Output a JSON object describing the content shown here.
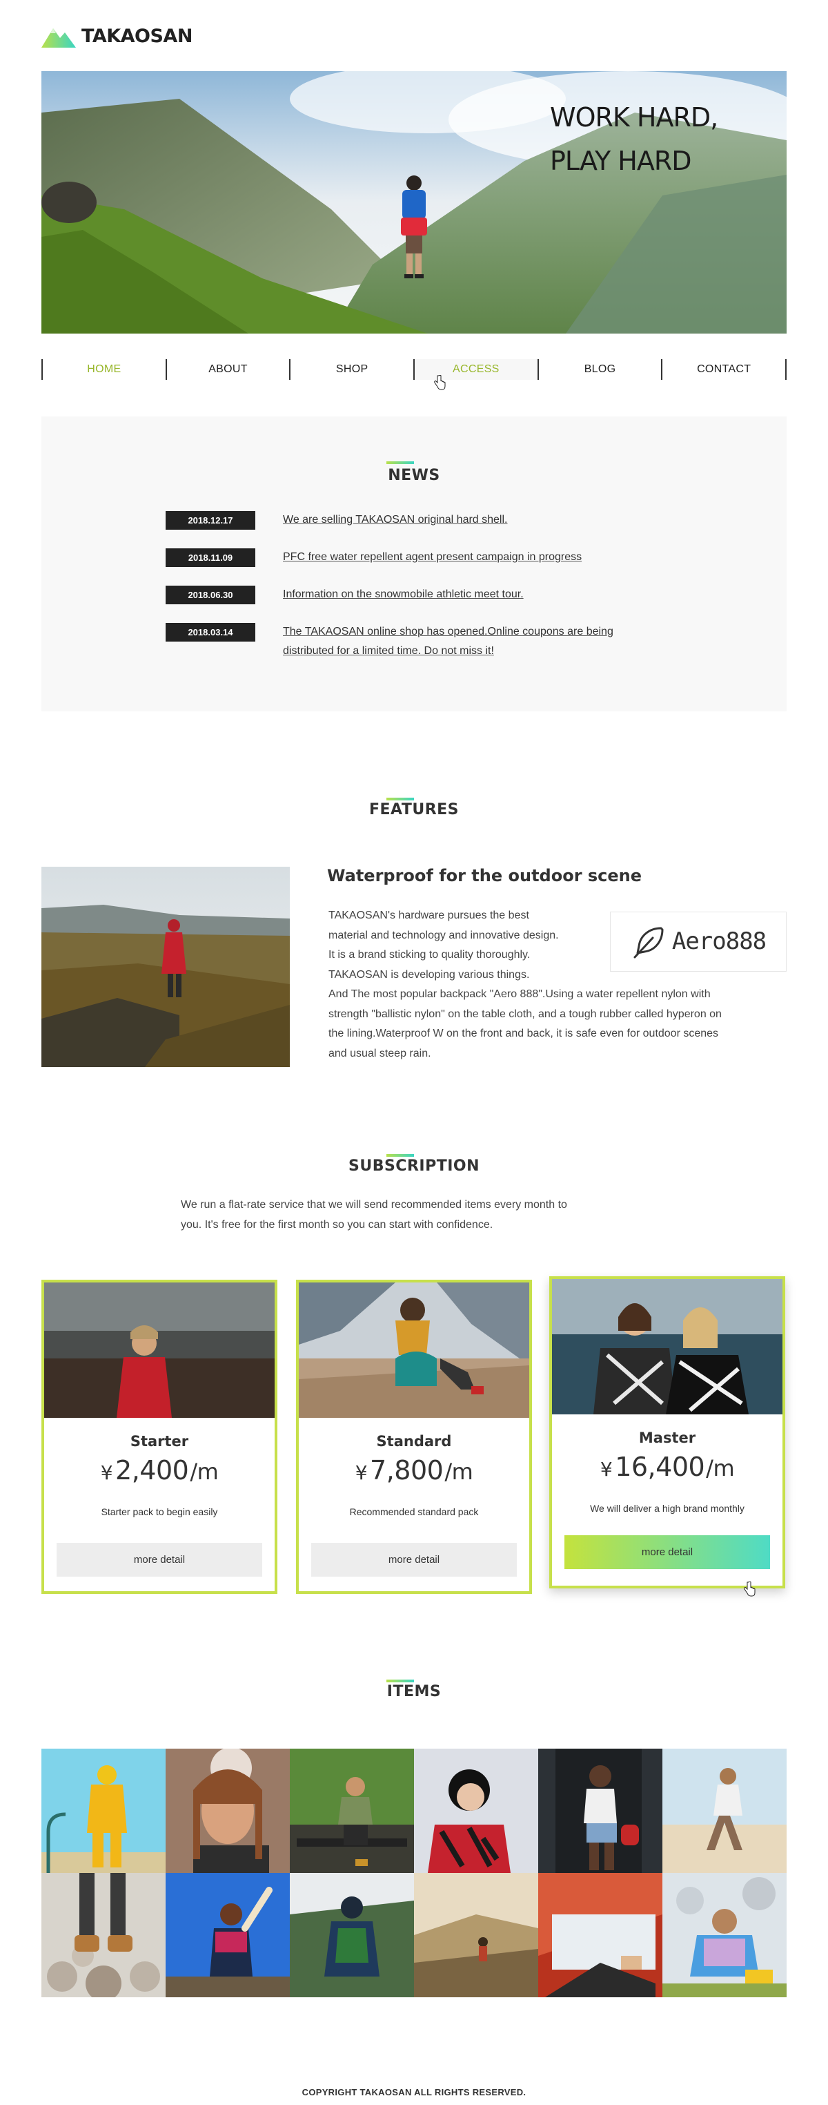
{
  "brand": {
    "name": "TAKAOSAN",
    "logo_icon": "mountain-icon"
  },
  "hero": {
    "line1": "WORK HARD,",
    "line2": "PLAY HARD"
  },
  "nav": {
    "items": [
      {
        "label": "HOME"
      },
      {
        "label": "ABOUT"
      },
      {
        "label": "SHOP"
      },
      {
        "label": "ACCESS"
      },
      {
        "label": "BLOG"
      },
      {
        "label": "CONTACT"
      }
    ],
    "active": "HOME",
    "hovered": "ACCESS"
  },
  "news": {
    "title": "NEWS",
    "items": [
      {
        "date": "2018.12.17",
        "text": "We are selling TAKAOSAN original hard shell."
      },
      {
        "date": "2018.11.09",
        "text": "PFC free water repellent agent present campaign in progress"
      },
      {
        "date": "2018.06.30",
        "text": "Information on the snowmobile athletic meet tour."
      },
      {
        "date": "2018.03.14",
        "line1": "The TAKAOSAN online shop has opened.Online coupons are being ",
        "line2": "distributed for a limited time. Do not miss it!"
      }
    ]
  },
  "features": {
    "title": "FEATURES",
    "heading": "Waterproof for the outdoor scene",
    "lines": [
      "TAKAOSAN's hardware pursues the best",
      "material and technology and innovative design.",
      "It is a brand sticking to quality thoroughly.",
      "TAKAOSAN is developing various things.",
      "And The most popular backpack \"Aero 888\".Using a water repellent nylon with",
      "strength \"ballistic nylon\" on the table cloth, and a tough rubber called hyperon on",
      "the lining.Waterproof W on the front and back, it is safe even for outdoor scenes",
      "and usual steep rain."
    ],
    "badge": {
      "label": "Aero888",
      "icon": "feather-icon"
    }
  },
  "subscription": {
    "title": "SUBSCRIPTION",
    "desc_line1": "We run a flat-rate service that we will send recommended items every month to",
    "desc_line2": "you. It's free for the first month so you can start with confidence.",
    "currency": "¥",
    "unit": "/m",
    "plans": [
      {
        "name": "Starter",
        "price": "2,400",
        "desc": "Starter pack to begin easily",
        "button": "more detail"
      },
      {
        "name": "Standard",
        "price": "7,800",
        "desc": "Recommended standard pack",
        "button": "more detail"
      },
      {
        "name": "Master",
        "price": "16,400",
        "desc": "We will deliver a high brand monthly",
        "button": "more detail"
      }
    ]
  },
  "items": {
    "title": "ITEMS"
  },
  "footer": {
    "copyright": "COPYRIGHT TAKAOSAN ALL RIGHTS RESERVED."
  },
  "colors": {
    "accent": "#97b62a",
    "gradient_start": "#c4e23d",
    "gradient_end": "#4fdbc5",
    "card_border": "#c7e04b"
  }
}
